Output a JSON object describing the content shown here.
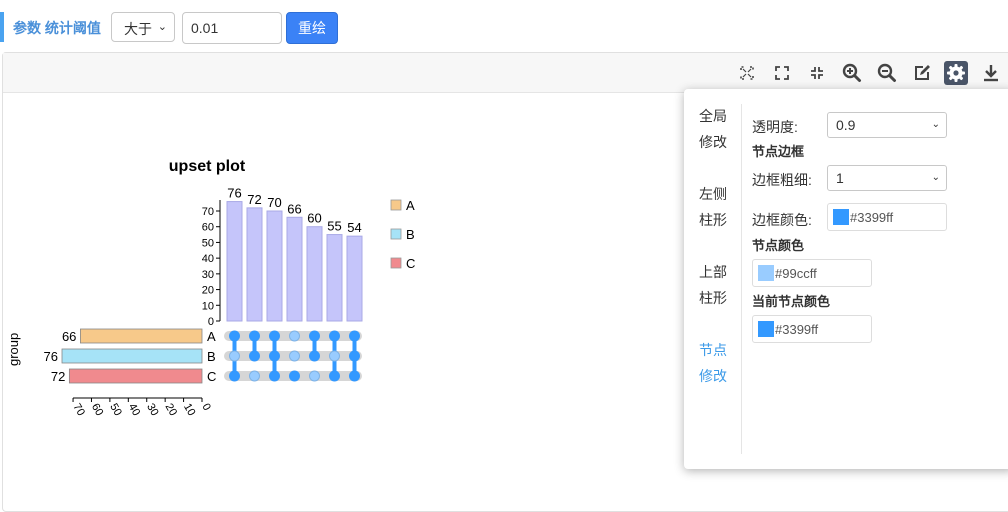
{
  "header": {
    "param_label": "参数 统计阈值",
    "operator": "大于",
    "threshold": "0.01",
    "redraw_label": "重绘"
  },
  "toolbar": {
    "icons": [
      "fullscreen-dashed-icon",
      "expand-icon",
      "shrink-icon",
      "zoom-in-icon",
      "zoom-out-icon",
      "edit-icon",
      "gear-icon",
      "download-icon"
    ]
  },
  "chart_data": {
    "type": "bar",
    "title": "upset plot",
    "ylabel": "group",
    "ylim": [
      0,
      70
    ],
    "yticks": [
      0,
      10,
      20,
      30,
      40,
      50,
      60,
      70
    ],
    "intersections": [
      {
        "value": 76,
        "sets": [
          "A",
          "C"
        ]
      },
      {
        "value": 72,
        "sets": [
          "A",
          "B"
        ]
      },
      {
        "value": 70,
        "sets": [
          "A",
          "B",
          "C"
        ]
      },
      {
        "value": 66,
        "sets": [
          "C"
        ]
      },
      {
        "value": 60,
        "sets": [
          "A",
          "B"
        ]
      },
      {
        "value": 55,
        "sets": [
          "A",
          "C"
        ]
      },
      {
        "value": 54,
        "sets": [
          "A",
          "B",
          "C"
        ]
      }
    ],
    "set_sizes": [
      {
        "name": "A",
        "value": 66
      },
      {
        "name": "B",
        "value": 76
      },
      {
        "name": "C",
        "value": 72
      }
    ],
    "set_axis_ticks": [
      70,
      60,
      50,
      40,
      30,
      20,
      10,
      0
    ],
    "legend": [
      {
        "name": "A",
        "color": "#f7c98a"
      },
      {
        "name": "B",
        "color": "#a6e3f7"
      },
      {
        "name": "C",
        "color": "#f08a8e"
      }
    ],
    "bar_color": "#c5c5fa",
    "dot_color": "#3399ff",
    "dot_inactive_color": "#99ccff",
    "track_color": "#d6d6d6"
  },
  "settings": {
    "menu": [
      "全局修改",
      "左侧柱形",
      "上部柱形",
      "节点修改"
    ],
    "active_menu": 3,
    "opacity_label": "透明度:",
    "opacity_value": "0.9",
    "node_border_heading": "节点边框",
    "border_width_label": "边框粗细:",
    "border_width_value": "1",
    "border_color_label": "边框颜色:",
    "border_color_value": "#3399ff",
    "node_color_heading": "节点颜色",
    "node_color_value": "#99ccff",
    "current_node_color_heading": "当前节点颜色",
    "current_node_color_value": "#3399ff"
  }
}
